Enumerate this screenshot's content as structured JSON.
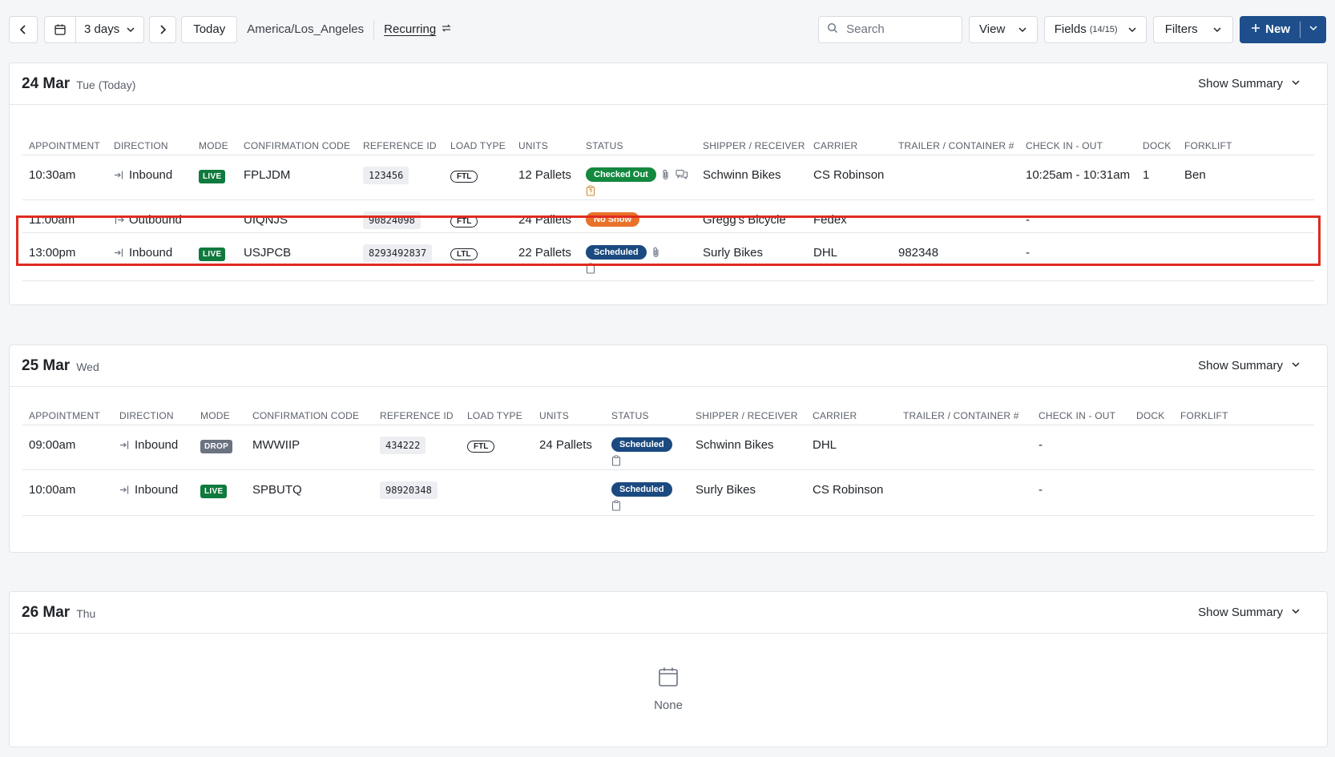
{
  "toolbar": {
    "range_label": "3 days",
    "today_label": "Today",
    "timezone": "America/Los_Angeles",
    "recurring_label": "Recurring",
    "search_placeholder": "Search",
    "view_label": "View",
    "fields_label": "Fields",
    "fields_count": "(14/15)",
    "filters_label": "Filters",
    "new_label": "New"
  },
  "colors": {
    "live": "#0f7a3d",
    "drop": "#6b7280",
    "checked_out": "#12893f",
    "no_show": "#e8722a",
    "scheduled": "#1b4a80",
    "primary": "#1e4f8c",
    "highlight": "#e02b20"
  },
  "days": [
    {
      "date": "24 Mar",
      "weekday": "Tue (Today)",
      "summary_label": "Show Summary",
      "columns": [
        "APPOINTMENT",
        "DIRECTION",
        "MODE",
        "CONFIRMATION CODE",
        "REFERENCE ID",
        "LOAD TYPE",
        "UNITS",
        "STATUS",
        "SHIPPER / RECEIVER",
        "CARRIER",
        "TRAILER / CONTAINER #",
        "CHECK IN - OUT",
        "DOCK",
        "FORKLIFT"
      ],
      "rows": [
        {
          "appointment": "10:30am",
          "direction": "Inbound",
          "mode": "LIVE",
          "confirmation": "FPLJDM",
          "reference": "123456",
          "load_type": "FTL",
          "units": "12 Pallets",
          "status": "Checked Out",
          "status_kind": "checked_out",
          "shipper": "Schwinn Bikes",
          "carrier": "CS Robinson",
          "trailer": "",
          "check": "10:25am - 10:31am",
          "dock": "1",
          "forklift": "Ben",
          "attach": true,
          "chat": true,
          "note": "doc-question"
        },
        {
          "appointment": "11:00am",
          "direction": "Outbound",
          "mode": "",
          "confirmation": "UIQNJS",
          "reference": "90824098",
          "load_type": "FTL",
          "units": "24 Pallets",
          "status": "No Show",
          "status_kind": "no_show",
          "shipper": "Gregg's Bicycle",
          "carrier": "Fedex",
          "trailer": "",
          "check": "-",
          "dock": "",
          "forklift": "",
          "attach": false,
          "chat": false,
          "note": ""
        },
        {
          "appointment": "13:00pm",
          "direction": "Inbound",
          "mode": "LIVE",
          "confirmation": "USJPCB",
          "reference": "8293492837",
          "load_type": "LTL",
          "units": "22 Pallets",
          "status": "Scheduled",
          "status_kind": "scheduled",
          "shipper": "Surly Bikes",
          "carrier": "DHL",
          "trailer": "982348",
          "check": "-",
          "dock": "",
          "forklift": "",
          "attach": true,
          "chat": false,
          "note": "clipboard",
          "highlight": true
        }
      ]
    },
    {
      "date": "25 Mar",
      "weekday": "Wed",
      "summary_label": "Show Summary",
      "columns": [
        "APPOINTMENT",
        "DIRECTION",
        "MODE",
        "CONFIRMATION CODE",
        "REFERENCE ID",
        "LOAD TYPE",
        "UNITS",
        "STATUS",
        "SHIPPER / RECEIVER",
        "CARRIER",
        "TRAILER / CONTAINER #",
        "CHECK IN - OUT",
        "DOCK",
        "FORKLIFT"
      ],
      "rows": [
        {
          "appointment": "09:00am",
          "direction": "Inbound",
          "mode": "DROP",
          "confirmation": "MWWIIP",
          "reference": "434222",
          "load_type": "FTL",
          "units": "24 Pallets",
          "status": "Scheduled",
          "status_kind": "scheduled",
          "shipper": "Schwinn Bikes",
          "carrier": "DHL",
          "trailer": "",
          "check": "-",
          "dock": "",
          "forklift": "",
          "attach": false,
          "chat": false,
          "note": "clipboard"
        },
        {
          "appointment": "10:00am",
          "direction": "Inbound",
          "mode": "LIVE",
          "confirmation": "SPBUTQ",
          "reference": "98920348",
          "load_type": "",
          "units": "",
          "status": "Scheduled",
          "status_kind": "scheduled",
          "shipper": "Surly Bikes",
          "carrier": "CS Robinson",
          "trailer": "",
          "check": "-",
          "dock": "",
          "forklift": "",
          "attach": false,
          "chat": false,
          "note": "clipboard"
        }
      ]
    },
    {
      "date": "26 Mar",
      "weekday": "Thu",
      "summary_label": "Show Summary",
      "empty_label": "None"
    }
  ]
}
